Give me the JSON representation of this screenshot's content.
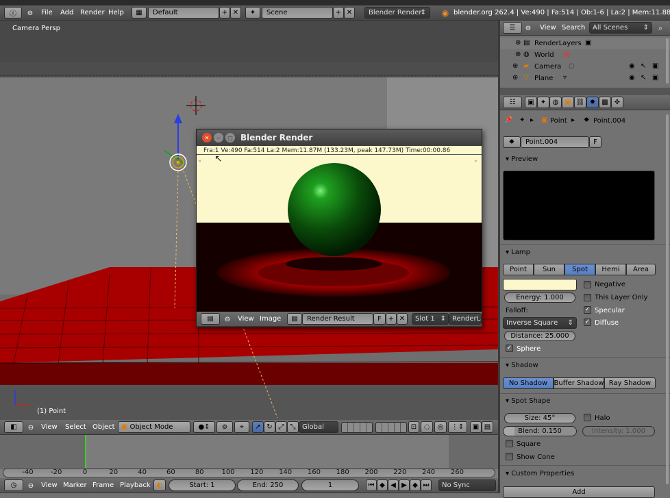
{
  "topbar": {
    "menus": [
      "File",
      "Add",
      "Render",
      "Help"
    ],
    "layout_value": "Default",
    "scene_value": "Scene",
    "engine_value": "Blender Render",
    "stats": "blender.org 262.4 | Ve:490 | Fa:514 | Ob:1-6 | La:2 | Mem:11.88M | (133.2"
  },
  "viewport": {
    "label": "Camera Persp",
    "object_label": "(1) Point"
  },
  "viewport_header": {
    "menus": [
      "View",
      "Select",
      "Object"
    ],
    "mode_value": "Object Mode",
    "orientation_value": "Global"
  },
  "render_window": {
    "title": "Blender Render",
    "status": "Fra:1  Ve:490 Fa:514 La:2 Mem:11.87M (133.23M, peak 147.73M) Time:00:00.86",
    "menus": [
      "View",
      "Image"
    ],
    "image_value": "Render Result",
    "f_label": "F",
    "slot_value": "Slot 1",
    "layer_value": "RenderLay"
  },
  "timeline": {
    "ticks": [
      "-40",
      "-20",
      "0",
      "20",
      "40",
      "60",
      "80",
      "100",
      "120",
      "140",
      "160",
      "180",
      "200",
      "220",
      "240",
      "260"
    ],
    "menus": [
      "View",
      "Marker",
      "Frame",
      "Playback"
    ],
    "start": "Start: 1",
    "end": "End: 250",
    "current": "1",
    "sync": "No Sync"
  },
  "outliner": {
    "menus": [
      "View",
      "Search"
    ],
    "filter_value": "All Scenes",
    "items": [
      "RenderLayers",
      "World",
      "Camera",
      "Plane"
    ]
  },
  "properties": {
    "breadcrumb": [
      "Point",
      "Point.004"
    ],
    "datablock_name": "Point.004",
    "datablock_f": "F",
    "preview_header": "Preview",
    "lamp_header": "Lamp",
    "lamp_types": [
      "Point",
      "Sun",
      "Spot",
      "Hemi",
      "Area"
    ],
    "lamp_type_active": "Spot",
    "negative": "Negative",
    "this_layer_only": "This Layer Only",
    "energy": "Energy: 1.000",
    "specular": "Specular",
    "diffuse": "Diffuse",
    "falloff_label": "Falloff:",
    "falloff_value": "Inverse Square",
    "distance": "Distance: 25.000",
    "sphere": "Sphere",
    "shadow_header": "Shadow",
    "shadow_types": [
      "No Shadow",
      "Buffer Shadow",
      "Ray Shadow"
    ],
    "spot_header": "Spot Shape",
    "size": "Size: 45°",
    "halo": "Halo",
    "blend": "Blend: 0.150",
    "intensity": "Intensity: 1.000",
    "square": "Square",
    "show_cone": "Show Cone",
    "custom_header": "Custom Properties",
    "add_label": "Add"
  },
  "colors": {
    "accent": "#5680c2",
    "floor": "#a00000",
    "render_bg": "#fdf8cc"
  }
}
